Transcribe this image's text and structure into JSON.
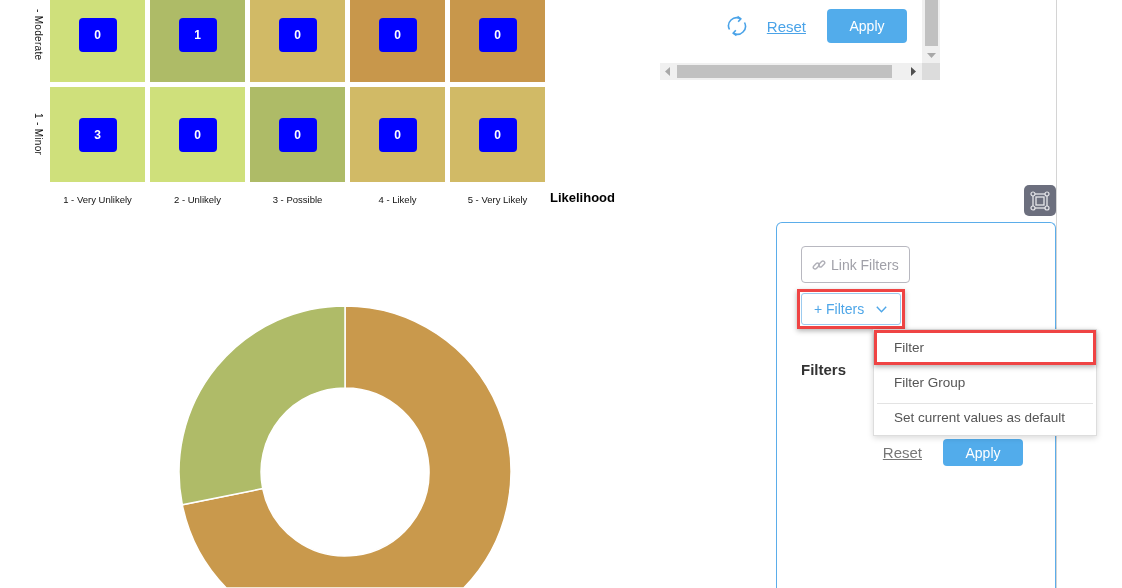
{
  "risk_matrix": {
    "rows": [
      {
        "label": "- Moderate",
        "cells": [
          {
            "count": "0",
            "color": "#cfe07b"
          },
          {
            "count": "1",
            "color": "#aebb67"
          },
          {
            "count": "0",
            "color": "#d1ba66"
          },
          {
            "count": "0",
            "color": "#c8974b"
          },
          {
            "count": "0",
            "color": "#c8974b"
          }
        ]
      },
      {
        "label": "1 - Minor",
        "cells": [
          {
            "count": "3",
            "color": "#cfe07b"
          },
          {
            "count": "0",
            "color": "#cfe07b"
          },
          {
            "count": "0",
            "color": "#aebb67"
          },
          {
            "count": "0",
            "color": "#d1ba66"
          },
          {
            "count": "0",
            "color": "#d1ba66"
          }
        ]
      }
    ],
    "x_labels": [
      "1 - Very Unlikely",
      "2 - Unlikely",
      "3 - Possible",
      "4 - Likely",
      "5 - Very Likely"
    ],
    "x_axis_title": "Likelihood"
  },
  "top_panel": {
    "reset": "Reset",
    "apply": "Apply"
  },
  "filter_panel": {
    "link_button": "Link Filters",
    "add_button": {
      "label": "+ Filters",
      "highlighted": true
    },
    "menu": [
      {
        "label": "Filter",
        "highlighted": true,
        "divider_above": false
      },
      {
        "label": "Filter Group",
        "highlighted": false,
        "divider_above": false
      },
      {
        "label": "Set current values as default",
        "highlighted": false,
        "divider_above": true
      }
    ],
    "heading": "Filters",
    "reset": "Reset",
    "apply": "Apply"
  }
}
